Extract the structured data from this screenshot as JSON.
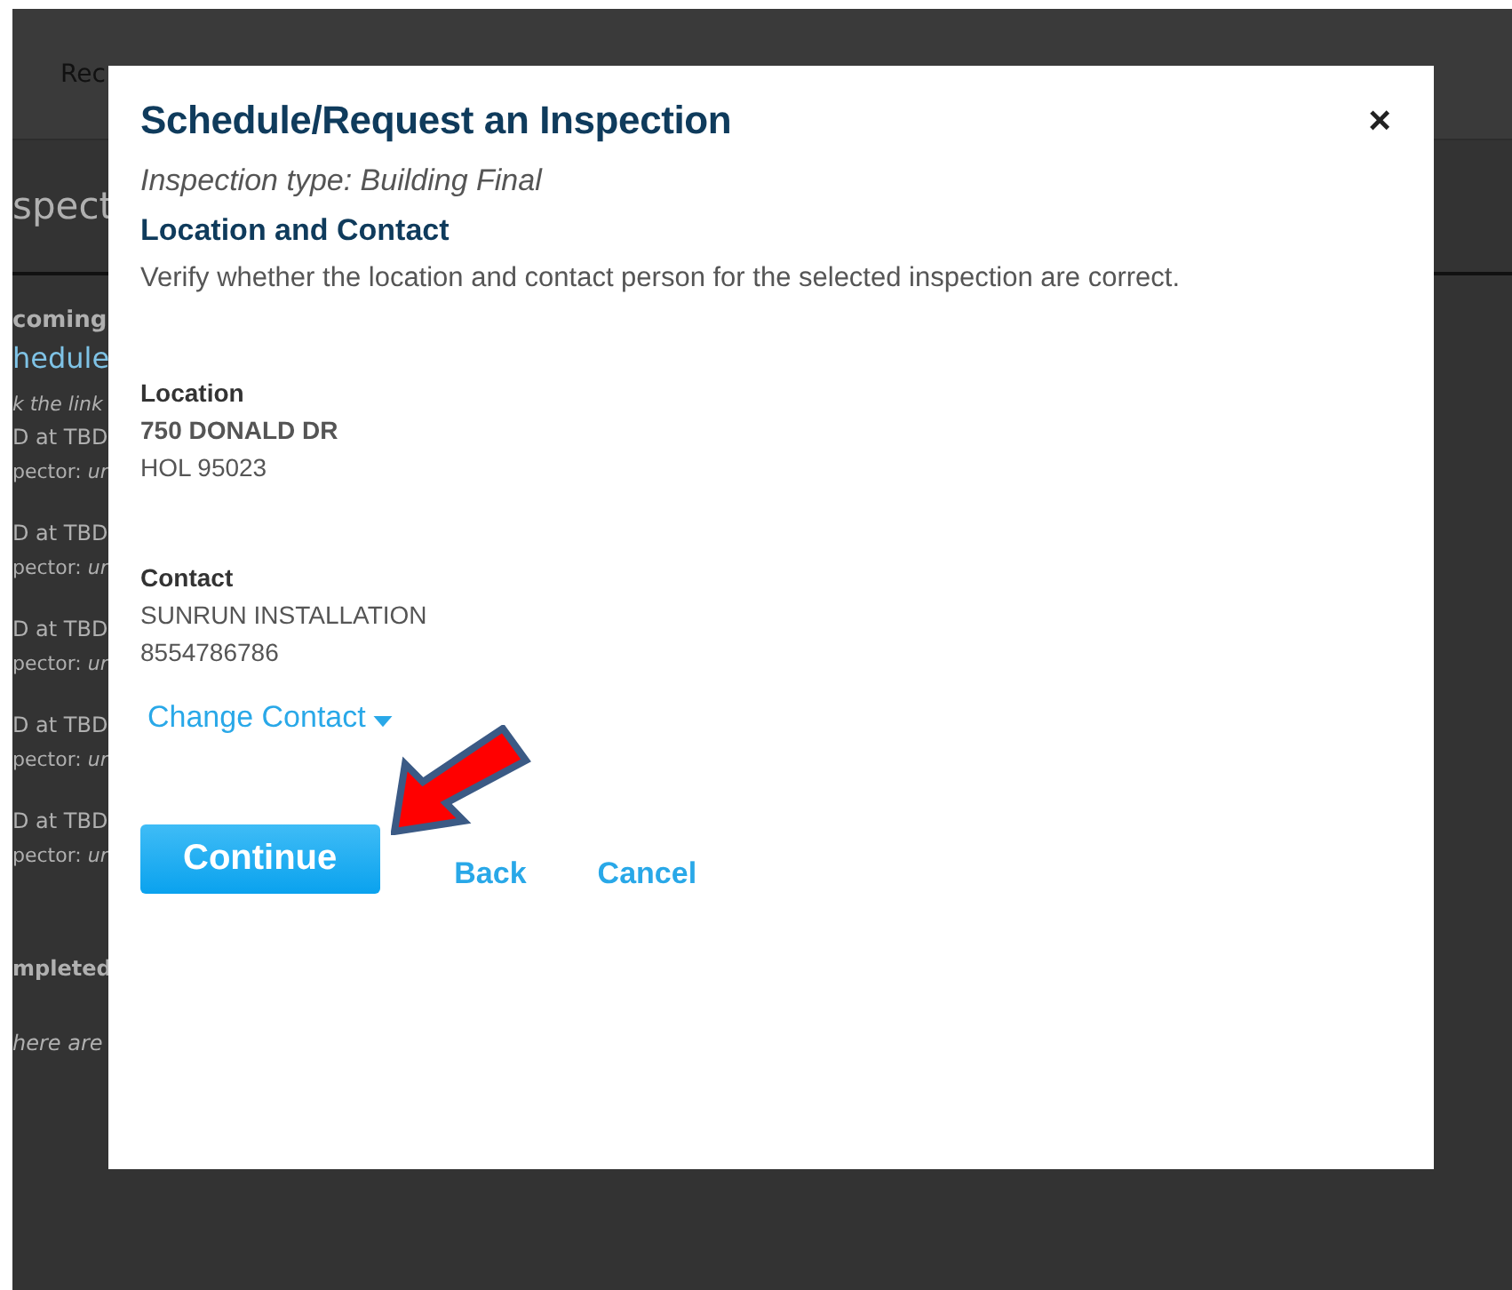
{
  "background_page": {
    "tab": "Rec",
    "heading": "spect",
    "section": "coming",
    "link": "hedule",
    "hint": "k the link",
    "entries": [
      {
        "time": "D at TBD",
        "inspector": "pector: *ur*"
      },
      {
        "time": "D at TBD",
        "inspector": "pector: *ur*"
      },
      {
        "time": "D at TBD",
        "inspector": "pector: *ur*"
      },
      {
        "time": "D at TBD",
        "inspector": "pector: *ur*"
      },
      {
        "time": "D at TBD",
        "inspector": "pector: *ur*"
      }
    ],
    "completed": "mpleted",
    "empty_note": "here are"
  },
  "dialog": {
    "title": "Schedule/Request an Inspection",
    "close": "×",
    "inspection_type": "Inspection type: Building Final",
    "section_title": "Location and Contact",
    "instructions": "Verify whether the location and contact person for the selected inspection are correct.",
    "location": {
      "label": "Location",
      "lines": [
        "750 DONALD DR",
        "HOL 95023"
      ]
    },
    "contact": {
      "label": "Contact",
      "lines": [
        "SUNRUN INSTALLATION",
        "8554786786"
      ]
    },
    "change_contact": "Change Contact",
    "buttons": [
      {
        "label": "Continue",
        "kind": "primary"
      },
      {
        "label": "Back",
        "kind": "link"
      },
      {
        "label": "Cancel",
        "kind": "link"
      }
    ]
  }
}
